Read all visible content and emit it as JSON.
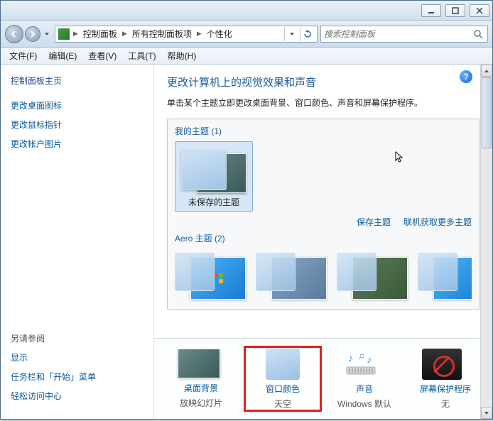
{
  "breadcrumb": {
    "items": [
      "控制面板",
      "所有控制面板项",
      "个性化"
    ]
  },
  "search": {
    "placeholder": "搜索控制面板"
  },
  "menu": {
    "file": "文件(F)",
    "edit": "编辑(E)",
    "view": "查看(V)",
    "tools": "工具(T)",
    "help": "帮助(H)"
  },
  "sidebar": {
    "home": "控制面板主页",
    "links": [
      "更改桌面图标",
      "更改鼠标指针",
      "更改帐户图片"
    ],
    "also_label": "另请参阅",
    "also_links": [
      "显示",
      "任务栏和「开始」菜单",
      "轻松访问中心"
    ]
  },
  "main": {
    "heading": "更改计算机上的视觉效果和声音",
    "subtext": "单击某个主题立即更改桌面背景、窗口颜色、声音和屏幕保护程序。",
    "my_themes_label": "我的主题 (1)",
    "unsaved_theme": "未保存的主题",
    "save_theme": "保存主题",
    "get_more": "联机获取更多主题",
    "aero_label": "Aero 主题 (2)"
  },
  "bottom": {
    "bg": {
      "title": "桌面背景",
      "sub": "放映幻灯片"
    },
    "color": {
      "title": "窗口颜色",
      "sub": "天空"
    },
    "sound": {
      "title": "声音",
      "sub": "Windows 默认"
    },
    "saver": {
      "title": "屏幕保护程序",
      "sub": "无"
    }
  }
}
